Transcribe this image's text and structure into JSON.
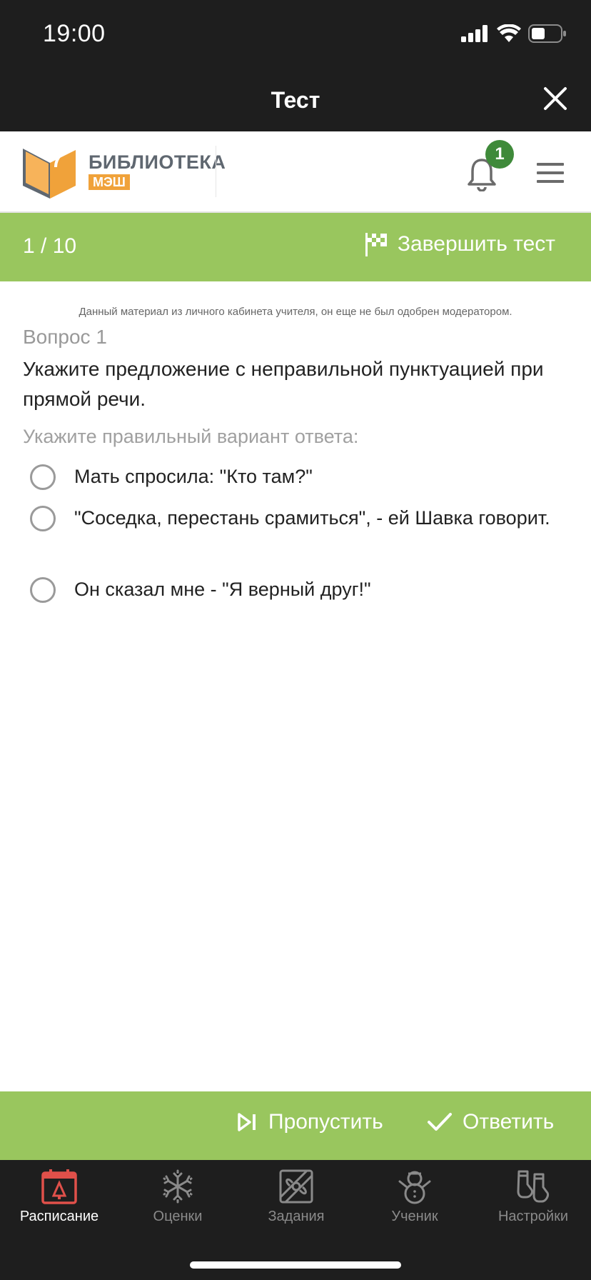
{
  "status_bar": {
    "time": "19:00"
  },
  "title_bar": {
    "title": "Тест"
  },
  "header": {
    "logo_line1": "БИБЛИОТЕКА",
    "logo_line2": "МЭШ",
    "notification_count": "1"
  },
  "progress": {
    "counter": "1 / 10",
    "finish_label": "Завершить тест"
  },
  "notice": "Данный материал из личного кабинета учителя, он еще не был одобрен модератором.",
  "question": {
    "number": "Вопрос 1",
    "text": "Укажите предложение с неправильной пунктуацией при прямой речи.",
    "hint": "Укажите правильный вариант ответа:",
    "options": [
      {
        "label": "Мать спросила: \"Кто там?\""
      },
      {
        "label": "\"Соседка, перестань срамиться\", - ей Шавка говорит."
      },
      {
        "label": "Он сказал мне - \"Я верный друг!\""
      }
    ]
  },
  "actions": {
    "skip_label": "Пропустить",
    "answer_label": "Ответить"
  },
  "tabs": [
    {
      "label": "Расписание",
      "icon": "calendar-icon",
      "active": true
    },
    {
      "label": "Оценки",
      "icon": "snowflake-icon",
      "active": false
    },
    {
      "label": "Задания",
      "icon": "gift-icon",
      "active": false
    },
    {
      "label": "Ученик",
      "icon": "snowman-icon",
      "active": false
    },
    {
      "label": "Настройки",
      "icon": "mittens-icon",
      "active": false
    }
  ],
  "colors": {
    "accent_green": "#99c65e",
    "badge_green": "#3f8a3a",
    "dark_bar": "#1e1e1e",
    "active_tab_red": "#e0504a",
    "logo_orange": "#f0a23a"
  }
}
